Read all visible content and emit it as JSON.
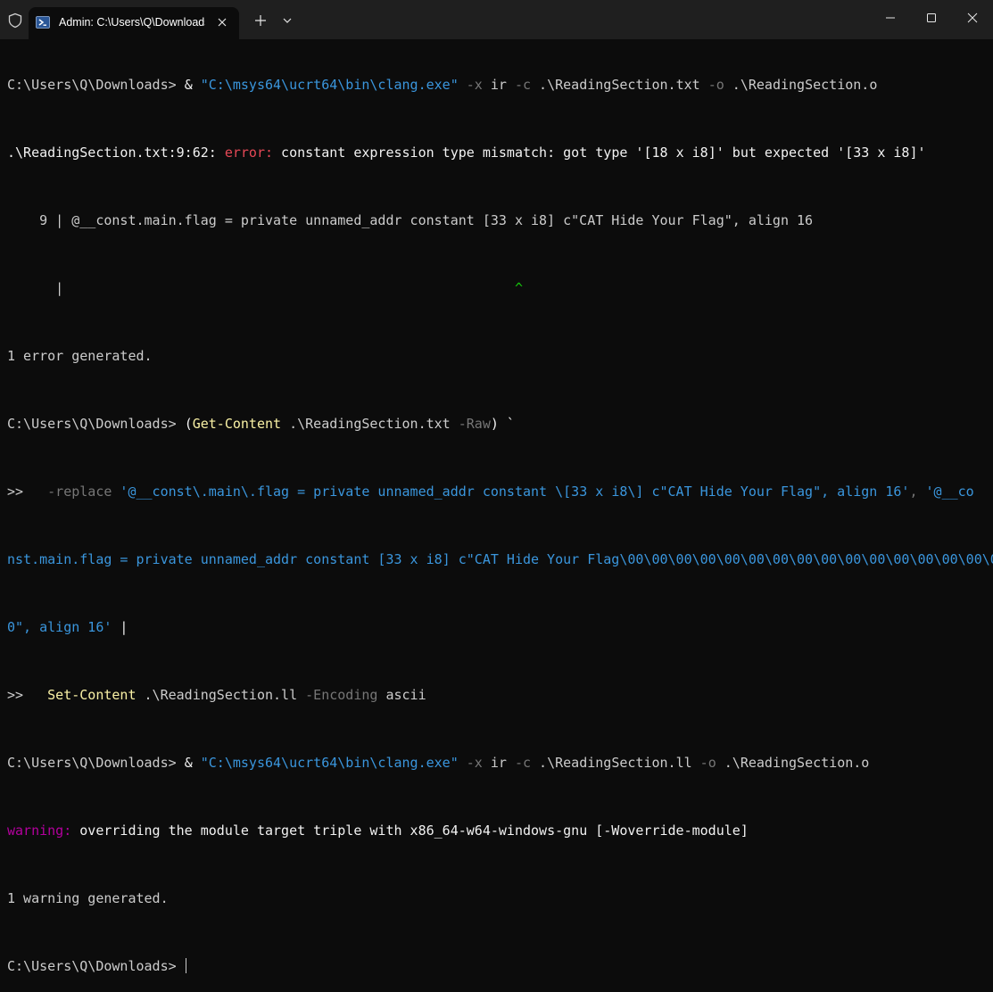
{
  "window": {
    "tab_title": "Admin: C:\\Users\\Q\\Downloads",
    "icons": {
      "shield": "shield-icon",
      "tab": "powershell-icon",
      "close_tab": "close-icon",
      "new_tab": "plus-icon",
      "dropdown": "chevron-down-icon",
      "minimize": "minimize-icon",
      "maximize": "maximize-icon",
      "close_window": "close-icon"
    }
  },
  "colors": {
    "background": "#0c0c0c",
    "titlebar": "#1f1f1f",
    "text": "#cccccc",
    "string": "#3a96dd",
    "parameter": "#767676",
    "command": "#f9f1a5",
    "error": "#e74856",
    "warning": "#b4009e",
    "caret": "#16c60c"
  },
  "terminal": {
    "l1": {
      "prompt": "C:\\Users\\Q\\Downloads> ",
      "op": "& ",
      "exe": "\"C:\\msys64\\ucrt64\\bin\\clang.exe\"",
      "p1": " -x",
      "a1": " ir",
      "p2": " -c",
      "a2": " .\\ReadingSection.txt",
      "p3": " -o",
      "a3": " .\\ReadingSection.o"
    },
    "l2": {
      "loc": ".\\ReadingSection.txt:9:62: ",
      "label": "error:",
      "msg": " constant expression type mismatch: got type '[18 x i8]' but expected '[33 x i8]'"
    },
    "l3": "    9 | @__const.main.flag = private unnamed_addr constant [33 x i8] c\"CAT Hide Your Flag\", align 16",
    "l4": {
      "gutter": "      |",
      "pad": "                                                        ",
      "caret": "^"
    },
    "l5": "1 error generated.",
    "l6": {
      "prompt": "C:\\Users\\Q\\Downloads> ",
      "open": "(",
      "cmd": "Get-Content",
      "arg": " .\\ReadingSection.txt",
      "param": " -Raw",
      "close": ")",
      "tick": " `"
    },
    "l7": {
      "cont": ">>   ",
      "param": "-replace",
      "str1": " '@__const\\.main\\.flag = private unnamed_addr constant \\[33 x i8\\] c\"CAT Hide Your Flag\", align 16'",
      "comma": ",",
      "str2": " '@__co"
    },
    "l8": "nst.main.flag = private unnamed_addr constant [33 x i8] c\"CAT Hide Your Flag\\00\\00\\00\\00\\00\\00\\00\\00\\00\\00\\00\\00\\00\\00\\00\\0",
    "l9": {
      "str": "0\", align 16'",
      "pipe": " |"
    },
    "l10": {
      "cont": ">>   ",
      "cmd": "Set-Content",
      "arg": " .\\ReadingSection.ll",
      "param": " -Encoding",
      "val": " ascii"
    },
    "l11": {
      "prompt": "C:\\Users\\Q\\Downloads> ",
      "op": "& ",
      "exe": "\"C:\\msys64\\ucrt64\\bin\\clang.exe\"",
      "p1": " -x",
      "a1": " ir",
      "p2": " -c",
      "a2": " .\\ReadingSection.ll",
      "p3": " -o",
      "a3": " .\\ReadingSection.o"
    },
    "l12": {
      "label": "warning:",
      "msg": " overriding the module target triple with x86_64-w64-windows-gnu [-Woverride-module]"
    },
    "l13": "1 warning generated.",
    "l14": {
      "prompt": "C:\\Users\\Q\\Downloads> "
    }
  }
}
